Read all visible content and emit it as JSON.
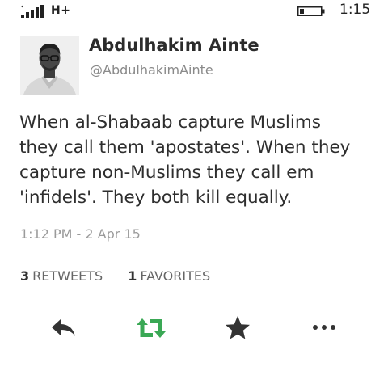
{
  "status_bar": {
    "network": "H+",
    "time": "1:15"
  },
  "author": {
    "name": "Abdulhakim Ainte",
    "handle": "@AbdulhakimAinte"
  },
  "tweet": {
    "lines": [
      "When al-Shabaab capture Muslims",
      "they call them 'apostates'. When they",
      "capture non-Muslims they call em",
      "'infidels'. They both kill equally."
    ],
    "timestamp": "1:12 PM - 2 Apr 15"
  },
  "stats": {
    "retweets_count": "3",
    "retweets_label": "RETWEETS",
    "favorites_count": "1",
    "favorites_label": "FAVORITES"
  },
  "actions": {
    "reply_icon": "reply-icon",
    "retweet_icon": "retweet-icon",
    "favorite_icon": "star-icon",
    "more_icon": "more-icon"
  },
  "colors": {
    "retweet_accent": "#3aa855",
    "icon_default": "#333333",
    "muted_text": "#8a8a8a"
  }
}
